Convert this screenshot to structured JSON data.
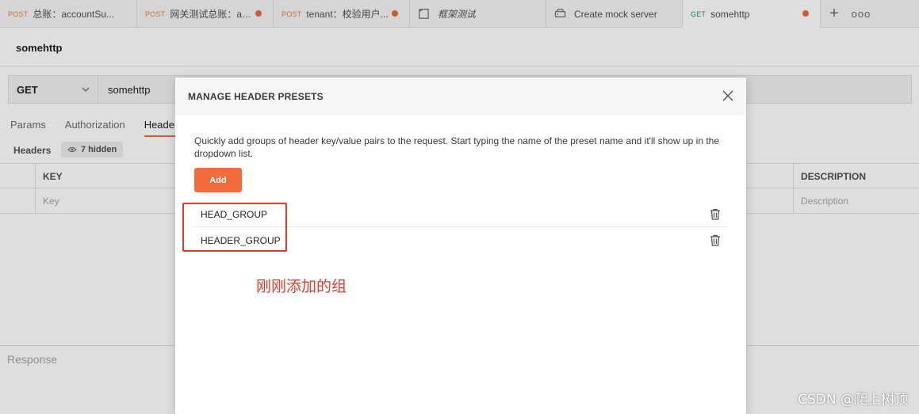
{
  "tabs": [
    {
      "method": "POST",
      "title": "总账：accountSu...",
      "dot": false,
      "icon": ""
    },
    {
      "method": "POST",
      "title": "网关测试总账：ap...",
      "dot": true,
      "icon": ""
    },
    {
      "method": "POST",
      "title": "tenant：校验用户...",
      "dot": true,
      "icon": ""
    },
    {
      "method": "",
      "title": "框架测试",
      "dot": false,
      "icon": "collection-icon"
    },
    {
      "method": "",
      "title": "Create mock server",
      "dot": false,
      "icon": "mock-server-icon"
    },
    {
      "method": "GET",
      "title": "somehttp",
      "dot": true,
      "icon": "",
      "active": true
    }
  ],
  "tabbar": {
    "plus": "+",
    "more": "ooo"
  },
  "request": {
    "name": "somehttp",
    "method": "GET",
    "url": "somehttp",
    "tabs": [
      "Params",
      "Authorization",
      "Header"
    ],
    "active_tab": "Header",
    "headers_label": "Headers",
    "hidden_count": "7 hidden",
    "table": {
      "key_header": "KEY",
      "desc_header": "DESCRIPTION",
      "key_placeholder": "Key",
      "desc_placeholder": "Description"
    },
    "response_label": "Response"
  },
  "modal": {
    "title": "MANAGE HEADER PRESETS",
    "description": "Quickly add groups of header key/value pairs to the request. Start typing the name of the preset name and it'll show up in the dropdown list.",
    "add_label": "Add",
    "presets": [
      "HEAD_GROUP",
      "HEADER_GROUP"
    ]
  },
  "annotation": "刚刚添加的组",
  "watermark": "CSDN @爬上树顶",
  "colors": {
    "accent": "#f26b3a",
    "annotation_red": "#e23b2e",
    "get_green": "#2e9a5e",
    "post_orange": "#e3823e"
  }
}
